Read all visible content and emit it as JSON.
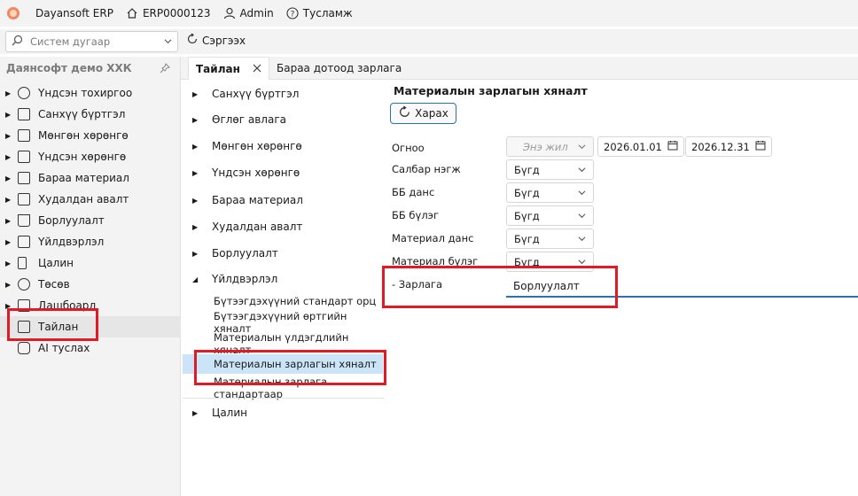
{
  "topbar": {
    "app_name": "Dayansoft ERP",
    "doc_id": "ERP0000123",
    "user": "Admin",
    "help": "Тусламж"
  },
  "toolbar": {
    "search_placeholder": "Систем дугаар",
    "refresh_label": "Сэргээх"
  },
  "sidebar": {
    "org_name": "Даянсофт демо ХХК",
    "items": [
      {
        "label": "Үндсэн тохиргоо",
        "icon": "gear-icon",
        "expandable": true
      },
      {
        "label": "Санхүү бүртгэл",
        "icon": "ledger-icon",
        "expandable": true
      },
      {
        "label": "Мөнгөн хөрөнгө",
        "icon": "cash-icon",
        "expandable": true
      },
      {
        "label": "Үндсэн хөрөнгө",
        "icon": "asset-icon",
        "expandable": true
      },
      {
        "label": "Бараа материал",
        "icon": "box-icon",
        "expandable": true
      },
      {
        "label": "Худалдан авалт",
        "icon": "purchase-icon",
        "expandable": true
      },
      {
        "label": "Борлуулалт",
        "icon": "cart-icon",
        "expandable": true
      },
      {
        "label": "Үйлдвэрлэл",
        "icon": "production-icon",
        "expandable": true
      },
      {
        "label": "Цалин",
        "icon": "salary-icon",
        "expandable": true
      },
      {
        "label": "Төсөв",
        "icon": "pie-chart-icon",
        "expandable": true
      },
      {
        "label": "Дашбоард",
        "icon": "dashboard-icon",
        "expandable": true
      },
      {
        "label": "Тайлан",
        "icon": "report-icon",
        "expandable": false
      },
      {
        "label": "AI туслах",
        "icon": "robot-icon",
        "expandable": false
      }
    ]
  },
  "tabs": [
    {
      "label": "Тайлан",
      "closable": true
    },
    {
      "label": "Бараа дотоод зарлага",
      "closable": false
    }
  ],
  "tree": {
    "nodes": [
      {
        "label": "Санхүү бүртгэл"
      },
      {
        "label": "Өглөг авлага"
      },
      {
        "label": "Мөнгөн хөрөнгө"
      },
      {
        "label": "Үндсэн хөрөнгө"
      },
      {
        "label": "Бараа материал"
      },
      {
        "label": "Худалдан авалт"
      },
      {
        "label": "Борлуулалт"
      },
      {
        "label": "Үйлдвэрлэл"
      }
    ],
    "children": [
      {
        "label": "Бүтээгдэхүүний стандарт орц"
      },
      {
        "label": "Бүтээгдэхүүний өртгийн хяналт"
      },
      {
        "label": "Материалын үлдэгдлийн хяналт"
      },
      {
        "label": "Материалын зарлагын хяналт"
      },
      {
        "label": "Материалын зарлага стандартаар"
      }
    ],
    "last_node": "Цалин"
  },
  "report": {
    "title": "Материалын зарлагын хяналт",
    "view_button": "Харах",
    "date_label": "Огноо",
    "period": "Энэ жил",
    "date_from": "2026.01.01",
    "date_to": "2026.12.31",
    "fields": [
      {
        "label": "Салбар нэгж",
        "value": "Бүгд"
      },
      {
        "label": "ББ данс",
        "value": "Бүгд"
      },
      {
        "label": "ББ бүлэг",
        "value": "Бүгд"
      },
      {
        "label": "Материал данс",
        "value": "Бүгд"
      },
      {
        "label": "Материал бүлэг",
        "value": "Бүгд"
      }
    ],
    "expense_label": "- Зарлага",
    "expense_value": "Борлуулалт"
  },
  "colors": {
    "accent": "#2d6fb3",
    "highlight": "#e01b24",
    "selection": "#cce4f7"
  }
}
